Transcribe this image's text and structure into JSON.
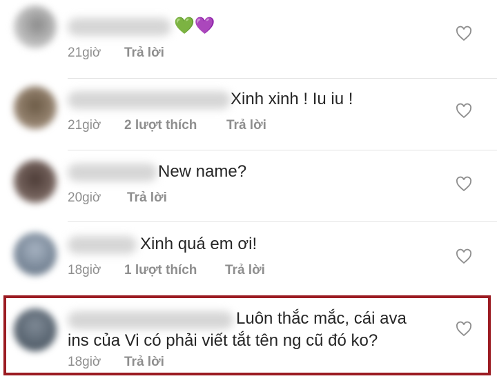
{
  "colors": {
    "highlight": "#9b1b22",
    "meta": "#8e8e8e",
    "text": "#262626"
  },
  "comments": [
    {
      "text": "💚💜",
      "time": "21giờ",
      "likes": "",
      "reply": "Trả lời",
      "icon": "heart-outline-icon"
    },
    {
      "text": "Xinh xinh ! Iu iu !",
      "time": "21giờ",
      "likes": "2 lượt thích",
      "reply": "Trả lời",
      "icon": "heart-outline-icon"
    },
    {
      "text": "New name?",
      "time": "20giờ",
      "likes": "",
      "reply": "Trả lời",
      "icon": "heart-outline-icon"
    },
    {
      "text": "Xinh quá em ơi!",
      "time": "18giờ",
      "likes": "1 lượt thích",
      "reply": "Trả lời",
      "icon": "heart-outline-icon"
    },
    {
      "text_line1": "Luôn thắc mắc, cái ava",
      "text_line2": "ins của Vi có phải viết tắt tên ng cũ đó ko?",
      "time": "18giờ",
      "likes": "",
      "reply": "Trả lời",
      "icon": "heart-outline-icon"
    }
  ]
}
